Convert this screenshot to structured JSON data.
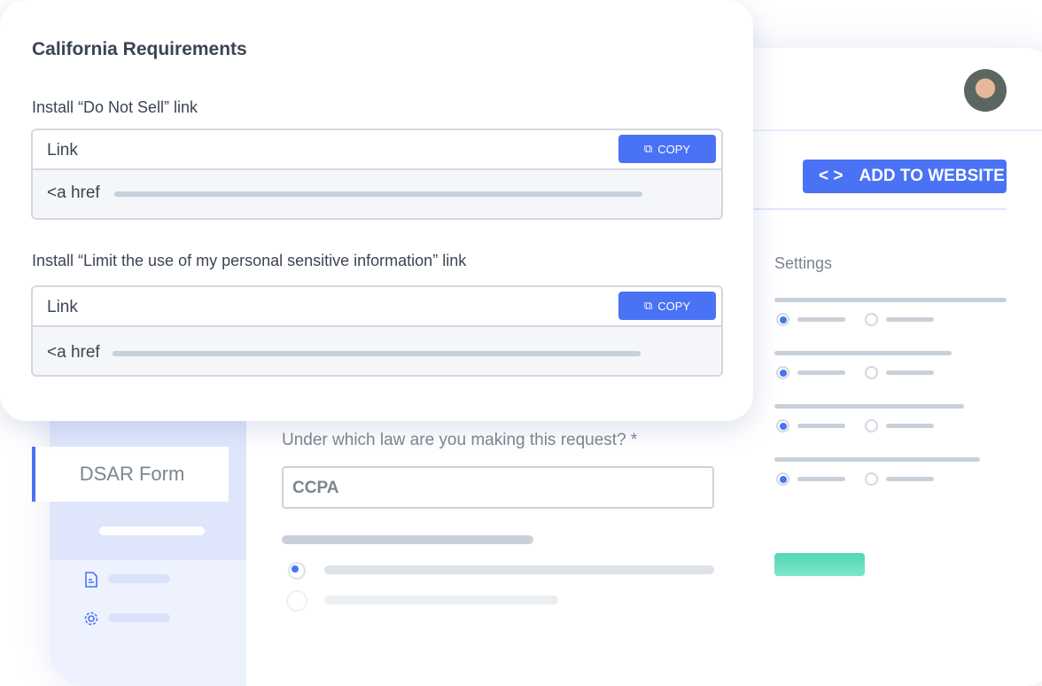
{
  "modal": {
    "title": "California Requirements",
    "sections": [
      {
        "label": "Install “Do Not Sell” link",
        "field_label": "Link",
        "copy_label": "COPY",
        "code_prefix": "<a href"
      },
      {
        "label": "Install “Limit the use of my personal sensitive information” link",
        "field_label": "Link",
        "copy_label": "COPY",
        "code_prefix": "<a href"
      }
    ]
  },
  "sidebar": {
    "active_item": "DSAR Form"
  },
  "form": {
    "question": "Under which law are you making this request? *",
    "answer": "CCPA"
  },
  "header": {
    "add_to_website": "ADD TO WEBSITE"
  },
  "settings": {
    "title": "Settings"
  },
  "colors": {
    "accent": "#4a72f5",
    "success": "#4fd8b4",
    "sidebar": "#dfe6fc"
  }
}
